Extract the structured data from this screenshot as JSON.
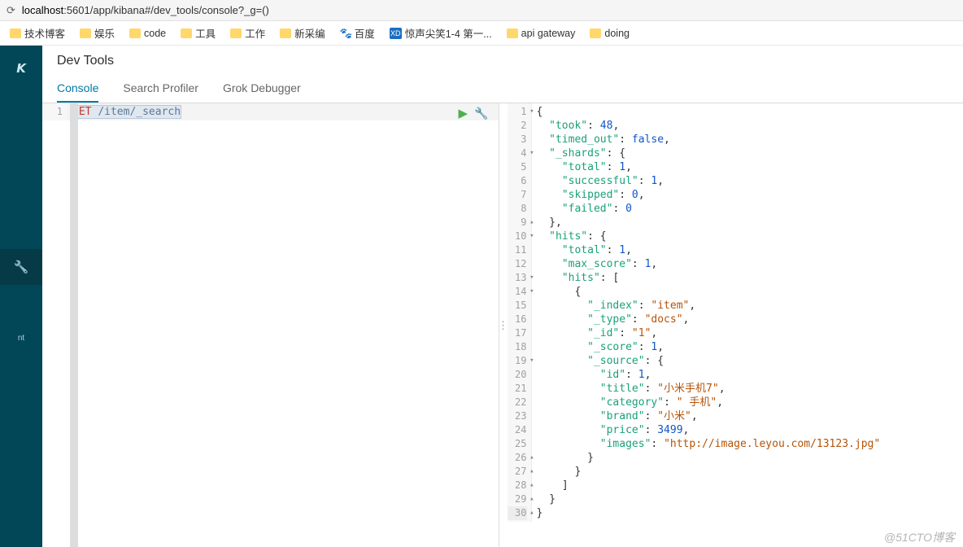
{
  "address_bar": {
    "url_prefix": "localhost",
    "url_rest": ":5601/app/kibana#/dev_tools/console?_g=()"
  },
  "bookmarks": [
    {
      "type": "folder",
      "label": "技术博客"
    },
    {
      "type": "folder",
      "label": "娱乐"
    },
    {
      "type": "folder",
      "label": "code"
    },
    {
      "type": "folder",
      "label": "工具"
    },
    {
      "type": "folder",
      "label": "工作"
    },
    {
      "type": "folder",
      "label": "新采编"
    },
    {
      "type": "baidu",
      "label": "百度"
    },
    {
      "type": "sq",
      "label": "惊声尖笑1-4 第一..."
    },
    {
      "type": "folder",
      "label": "api gateway"
    },
    {
      "type": "folder",
      "label": "doing"
    }
  ],
  "sidebar": {
    "visible_label": "nt"
  },
  "page": {
    "title": "Dev Tools"
  },
  "tabs": [
    {
      "label": "Console",
      "active": true
    },
    {
      "label": "Search Profiler",
      "active": false
    },
    {
      "label": "Grok Debugger",
      "active": false
    }
  ],
  "request": {
    "line_no": "1",
    "method": "GET",
    "path": "/item/_search"
  },
  "response_lines": [
    {
      "n": "1",
      "fold": "d",
      "t": [
        [
          "p",
          "{"
        ]
      ]
    },
    {
      "n": "2",
      "t": [
        [
          "sp",
          "  "
        ],
        [
          "k",
          "\"took\""
        ],
        [
          "p",
          ": "
        ],
        [
          "num",
          "48"
        ],
        [
          "p",
          ","
        ]
      ]
    },
    {
      "n": "3",
      "t": [
        [
          "sp",
          "  "
        ],
        [
          "k",
          "\"timed_out\""
        ],
        [
          "p",
          ": "
        ],
        [
          "b",
          "false"
        ],
        [
          "p",
          ","
        ]
      ]
    },
    {
      "n": "4",
      "fold": "d",
      "t": [
        [
          "sp",
          "  "
        ],
        [
          "k",
          "\"_shards\""
        ],
        [
          "p",
          ": {"
        ]
      ]
    },
    {
      "n": "5",
      "t": [
        [
          "sp",
          "    "
        ],
        [
          "k",
          "\"total\""
        ],
        [
          "p",
          ": "
        ],
        [
          "num",
          "1"
        ],
        [
          "p",
          ","
        ]
      ]
    },
    {
      "n": "6",
      "t": [
        [
          "sp",
          "    "
        ],
        [
          "k",
          "\"successful\""
        ],
        [
          "p",
          ": "
        ],
        [
          "num",
          "1"
        ],
        [
          "p",
          ","
        ]
      ]
    },
    {
      "n": "7",
      "t": [
        [
          "sp",
          "    "
        ],
        [
          "k",
          "\"skipped\""
        ],
        [
          "p",
          ": "
        ],
        [
          "num",
          "0"
        ],
        [
          "p",
          ","
        ]
      ]
    },
    {
      "n": "8",
      "t": [
        [
          "sp",
          "    "
        ],
        [
          "k",
          "\"failed\""
        ],
        [
          "p",
          ": "
        ],
        [
          "num",
          "0"
        ]
      ]
    },
    {
      "n": "9",
      "fold": "u",
      "t": [
        [
          "sp",
          "  "
        ],
        [
          "p",
          "},"
        ]
      ]
    },
    {
      "n": "10",
      "fold": "d",
      "t": [
        [
          "sp",
          "  "
        ],
        [
          "k",
          "\"hits\""
        ],
        [
          "p",
          ": {"
        ]
      ]
    },
    {
      "n": "11",
      "t": [
        [
          "sp",
          "    "
        ],
        [
          "k",
          "\"total\""
        ],
        [
          "p",
          ": "
        ],
        [
          "num",
          "1"
        ],
        [
          "p",
          ","
        ]
      ]
    },
    {
      "n": "12",
      "t": [
        [
          "sp",
          "    "
        ],
        [
          "k",
          "\"max_score\""
        ],
        [
          "p",
          ": "
        ],
        [
          "num",
          "1"
        ],
        [
          "p",
          ","
        ]
      ]
    },
    {
      "n": "13",
      "fold": "d",
      "t": [
        [
          "sp",
          "    "
        ],
        [
          "k",
          "\"hits\""
        ],
        [
          "p",
          ": ["
        ]
      ]
    },
    {
      "n": "14",
      "fold": "d",
      "t": [
        [
          "sp",
          "      "
        ],
        [
          "p",
          "{"
        ]
      ]
    },
    {
      "n": "15",
      "t": [
        [
          "sp",
          "        "
        ],
        [
          "k",
          "\"_index\""
        ],
        [
          "p",
          ": "
        ],
        [
          "s",
          "\"item\""
        ],
        [
          "p",
          ","
        ]
      ]
    },
    {
      "n": "16",
      "t": [
        [
          "sp",
          "        "
        ],
        [
          "k",
          "\"_type\""
        ],
        [
          "p",
          ": "
        ],
        [
          "s",
          "\"docs\""
        ],
        [
          "p",
          ","
        ]
      ]
    },
    {
      "n": "17",
      "t": [
        [
          "sp",
          "        "
        ],
        [
          "k",
          "\"_id\""
        ],
        [
          "p",
          ": "
        ],
        [
          "s",
          "\"1\""
        ],
        [
          "p",
          ","
        ]
      ]
    },
    {
      "n": "18",
      "t": [
        [
          "sp",
          "        "
        ],
        [
          "k",
          "\"_score\""
        ],
        [
          "p",
          ": "
        ],
        [
          "num",
          "1"
        ],
        [
          "p",
          ","
        ]
      ]
    },
    {
      "n": "19",
      "fold": "d",
      "t": [
        [
          "sp",
          "        "
        ],
        [
          "k",
          "\"_source\""
        ],
        [
          "p",
          ": {"
        ]
      ]
    },
    {
      "n": "20",
      "t": [
        [
          "sp",
          "          "
        ],
        [
          "k",
          "\"id\""
        ],
        [
          "p",
          ": "
        ],
        [
          "num",
          "1"
        ],
        [
          "p",
          ","
        ]
      ]
    },
    {
      "n": "21",
      "t": [
        [
          "sp",
          "          "
        ],
        [
          "k",
          "\"title\""
        ],
        [
          "p",
          ": "
        ],
        [
          "s",
          "\"小米手机7\""
        ],
        [
          "p",
          ","
        ]
      ]
    },
    {
      "n": "22",
      "t": [
        [
          "sp",
          "          "
        ],
        [
          "k",
          "\"category\""
        ],
        [
          "p",
          ": "
        ],
        [
          "s",
          "\" 手机\""
        ],
        [
          "p",
          ","
        ]
      ]
    },
    {
      "n": "23",
      "t": [
        [
          "sp",
          "          "
        ],
        [
          "k",
          "\"brand\""
        ],
        [
          "p",
          ": "
        ],
        [
          "s",
          "\"小米\""
        ],
        [
          "p",
          ","
        ]
      ]
    },
    {
      "n": "24",
      "t": [
        [
          "sp",
          "          "
        ],
        [
          "k",
          "\"price\""
        ],
        [
          "p",
          ": "
        ],
        [
          "num",
          "3499"
        ],
        [
          "p",
          ","
        ]
      ]
    },
    {
      "n": "25",
      "t": [
        [
          "sp",
          "          "
        ],
        [
          "k",
          "\"images\""
        ],
        [
          "p",
          ": "
        ],
        [
          "s",
          "\"http://image.leyou.com/13123.jpg\""
        ]
      ]
    },
    {
      "n": "26",
      "fold": "u",
      "t": [
        [
          "sp",
          "        "
        ],
        [
          "p",
          "}"
        ]
      ]
    },
    {
      "n": "27",
      "fold": "u",
      "t": [
        [
          "sp",
          "      "
        ],
        [
          "p",
          "}"
        ]
      ]
    },
    {
      "n": "28",
      "fold": "u",
      "t": [
        [
          "sp",
          "    "
        ],
        [
          "p",
          "]"
        ]
      ]
    },
    {
      "n": "29",
      "fold": "u",
      "t": [
        [
          "sp",
          "  "
        ],
        [
          "p",
          "}"
        ]
      ]
    },
    {
      "n": "30",
      "fold": "u",
      "last": true,
      "t": [
        [
          "p",
          "}"
        ]
      ]
    }
  ],
  "watermark": "@51CTO博客"
}
